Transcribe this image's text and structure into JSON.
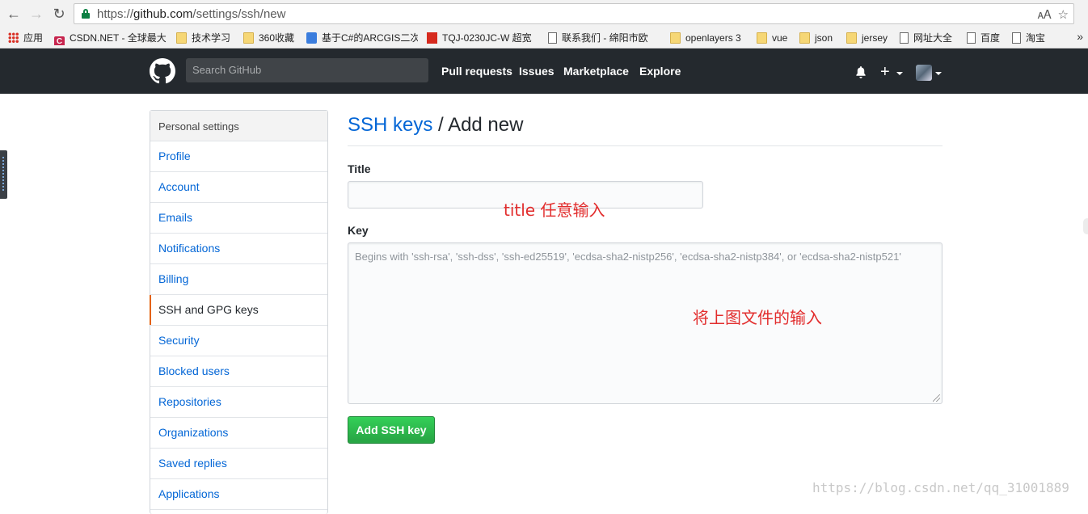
{
  "browser": {
    "url_scheme": "https://",
    "url_host": "github.com",
    "url_path": "/settings/ssh/new",
    "bookmarks": [
      {
        "label": "应用",
        "icon": "apps-grid-icon"
      },
      {
        "label": "CSDN.NET - 全球最大",
        "icon": "csdn-icon"
      },
      {
        "label": "技术学习",
        "icon": "folder-icon"
      },
      {
        "label": "360收藏",
        "icon": "folder-icon"
      },
      {
        "label": "基于C#的ARCGIS二次",
        "icon": "page-icon"
      },
      {
        "label": "TQJ-0230JC-W 超宽",
        "icon": "red-square-icon"
      },
      {
        "label": "联系我们 - 绵阳市欧",
        "icon": "page-icon"
      },
      {
        "label": "openlayers 3",
        "icon": "folder-icon"
      },
      {
        "label": "vue",
        "icon": "folder-icon"
      },
      {
        "label": "json",
        "icon": "folder-icon"
      },
      {
        "label": "jersey",
        "icon": "folder-icon"
      },
      {
        "label": "网址大全",
        "icon": "page-icon"
      },
      {
        "label": "百度",
        "icon": "page-icon"
      },
      {
        "label": "淘宝",
        "icon": "page-icon"
      }
    ],
    "more": "»"
  },
  "header": {
    "search_placeholder": "Search GitHub",
    "nav": [
      "Pull requests",
      "Issues",
      "Marketplace",
      "Explore"
    ]
  },
  "sidebar": {
    "heading": "Personal settings",
    "items": [
      {
        "label": "Profile"
      },
      {
        "label": "Account"
      },
      {
        "label": "Emails"
      },
      {
        "label": "Notifications"
      },
      {
        "label": "Billing"
      },
      {
        "label": "SSH and GPG keys",
        "selected": true
      },
      {
        "label": "Security"
      },
      {
        "label": "Blocked users"
      },
      {
        "label": "Repositories"
      },
      {
        "label": "Organizations"
      },
      {
        "label": "Saved replies"
      },
      {
        "label": "Applications"
      }
    ]
  },
  "main": {
    "crumb_link": "SSH keys",
    "crumb_sep": " / ",
    "crumb_current": "Add new",
    "title_label": "Title",
    "title_value": "",
    "key_label": "Key",
    "key_placeholder": "Begins with 'ssh-rsa', 'ssh-dss', 'ssh-ed25519', 'ecdsa-sha2-nistp256', 'ecdsa-sha2-nistp384', or 'ecdsa-sha2-nistp521'",
    "submit_label": "Add SSH key"
  },
  "annotations": {
    "title_note": "title 任意输入",
    "key_note": "将上图文件的输入"
  },
  "watermark": "https://blog.csdn.net/qq_31001889",
  "colors": {
    "header_bg": "#24292e",
    "link": "#0366d6",
    "selected_marker": "#e36209",
    "button_green": "#28a745",
    "annotation_red": "#e22d2d"
  }
}
